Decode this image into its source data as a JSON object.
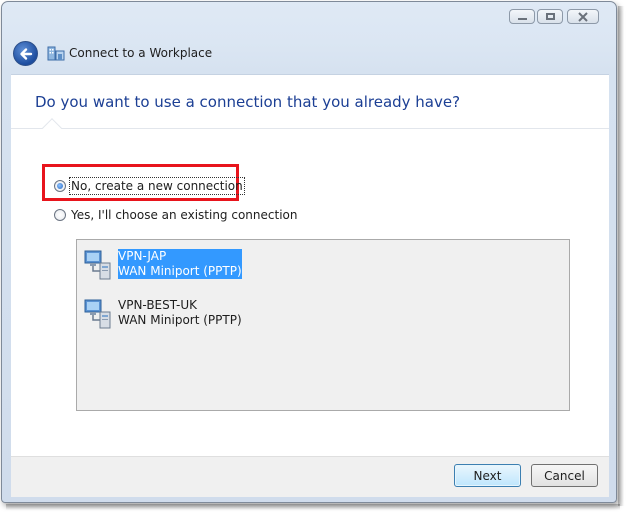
{
  "window": {
    "title": "Connect to a Workplace"
  },
  "icons": {
    "back": "back-arrow-icon",
    "header": "workplace-network-icon",
    "connection": "network-computer-icon"
  },
  "page": {
    "heading": "Do you want to use a connection that you already have?"
  },
  "options": [
    {
      "label": "No, create a new connection",
      "checked": true
    },
    {
      "label": "Yes, I'll choose an existing connection",
      "checked": false
    }
  ],
  "connections": [
    {
      "name": "VPN-JAP",
      "type": "WAN Miniport (PPTP)",
      "selected": true
    },
    {
      "name": "VPN-BEST-UK",
      "type": "WAN Miniport (PPTP)",
      "selected": false
    }
  ],
  "footer": {
    "next_label": "Next",
    "cancel_label": "Cancel"
  },
  "colors": {
    "heading": "#1c3f94",
    "highlight": "#e8141c",
    "selection": "#3399ff"
  }
}
